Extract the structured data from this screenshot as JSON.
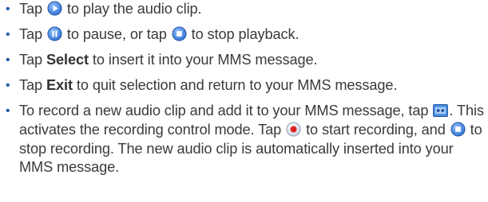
{
  "bullet_char": "•",
  "colors": {
    "text": "#3a3a3a",
    "bullet": "#1f5fb2",
    "icon_blue": "#2f6fd0",
    "icon_red": "#e02020"
  },
  "items": [
    {
      "parts": [
        "Tap ",
        " to play the audio clip."
      ],
      "icons": [
        "play-circle-icon"
      ]
    },
    {
      "parts": [
        "Tap ",
        " to pause, or tap ",
        " to stop playback."
      ],
      "icons": [
        "pause-circle-icon",
        "stop-circle-icon"
      ]
    },
    {
      "pre": "Tap ",
      "bold": "Select",
      "post": " to insert it into your MMS message."
    },
    {
      "pre": "Tap ",
      "bold": "Exit",
      "post": " to quit selection and return to your MMS message."
    },
    {
      "parts": [
        "To record a new audio clip and add it to your MMS message, tap ",
        ". This activates the recording control mode. Tap ",
        " to start recording, and ",
        " to stop recording. The new audio clip is automatically inserted into your MMS message."
      ],
      "icons": [
        "record-mode-icon",
        "record-circle-icon",
        "stop-circle-icon"
      ]
    }
  ]
}
